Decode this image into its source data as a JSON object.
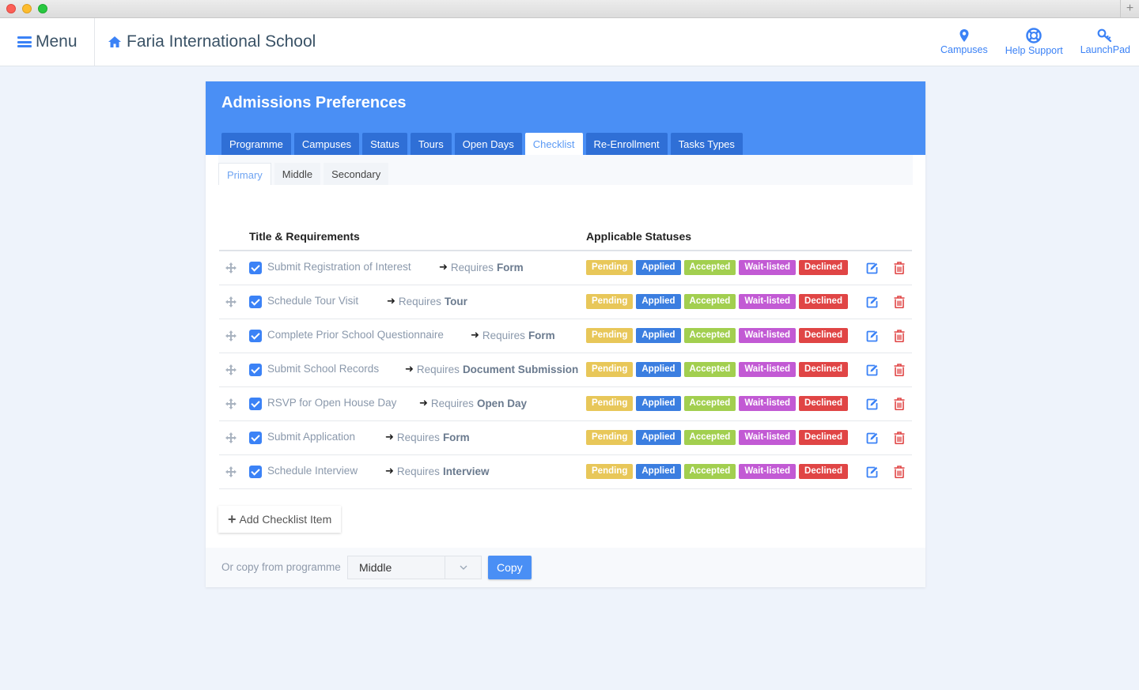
{
  "header": {
    "menu_label": "Menu",
    "school_name": "Faria International School",
    "nav": [
      {
        "label": "Campuses",
        "icon": "map-pin-icon"
      },
      {
        "label": "Help Support",
        "icon": "lifebuoy-icon"
      },
      {
        "label": "LaunchPad",
        "icon": "key-icon"
      }
    ]
  },
  "page": {
    "title": "Admissions Preferences",
    "tabs": [
      "Programme",
      "Campuses",
      "Status",
      "Tours",
      "Open Days",
      "Checklist",
      "Re-Enrollment",
      "Tasks Types"
    ],
    "active_tab": "Checklist",
    "subtabs": [
      "Primary",
      "Middle",
      "Secondary"
    ],
    "active_subtab": "Primary"
  },
  "table": {
    "col_title": "Title & Requirements",
    "col_statuses": "Applicable Statuses",
    "requires_prefix": "Requires",
    "statuses": [
      "Pending",
      "Applied",
      "Accepted",
      "Wait-listed",
      "Declined"
    ],
    "rows": [
      {
        "title": "Submit Registration of Interest",
        "requirement": "Form"
      },
      {
        "title": "Schedule Tour Visit",
        "requirement": "Tour"
      },
      {
        "title": "Complete Prior School Questionnaire",
        "requirement": "Form"
      },
      {
        "title": "Submit School Records",
        "requirement": "Document Submission"
      },
      {
        "title": "RSVP for Open House Day",
        "requirement": "Open Day"
      },
      {
        "title": "Submit Application",
        "requirement": "Form"
      },
      {
        "title": "Schedule Interview",
        "requirement": "Interview"
      }
    ]
  },
  "actions": {
    "add_label": "Add Checklist Item",
    "copy_from_label": "Or copy from programme",
    "copy_select_value": "Middle",
    "copy_button": "Copy"
  },
  "colors": {
    "accent": "#4a8ff5",
    "pending": "#e8c759",
    "applied": "#3b7ee0",
    "accepted": "#a2cf4f",
    "waitlisted": "#c25ad4",
    "declined": "#e04545"
  }
}
